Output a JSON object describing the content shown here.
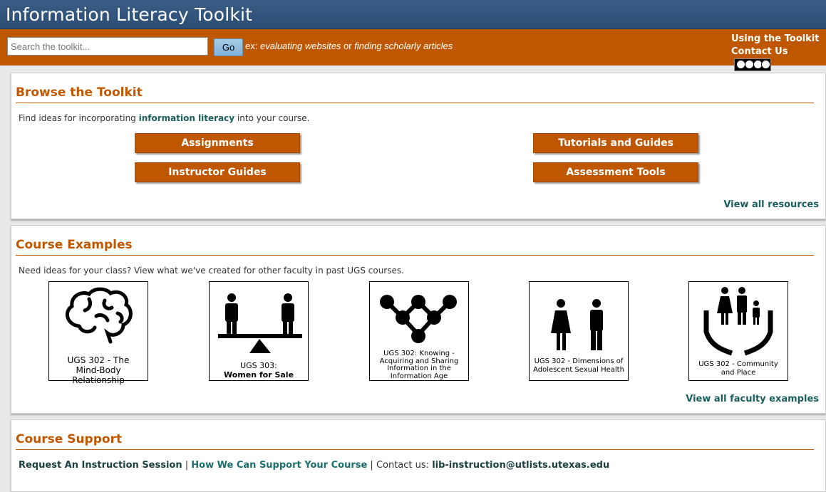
{
  "header": {
    "title": "Information Literacy Toolkit",
    "search_placeholder": "Search the toolkit...",
    "go_label": "Go",
    "hint_prefix": "ex: ",
    "hint_example1": "evaluating websites",
    "hint_or": " or ",
    "hint_example2": "finding scholarly articles",
    "link_using": "Using the Toolkit",
    "link_contact": "Contact Us"
  },
  "browse": {
    "heading": "Browse the Toolkit",
    "intro_before": "Find ideas for incorporating ",
    "intro_strong": "information literacy",
    "intro_after": " into your course.",
    "buttons": [
      "Assignments",
      "Tutorials and Guides",
      "Instructor Guides",
      "Assessment Tools"
    ],
    "view_all": "View all resources"
  },
  "courses": {
    "heading": "Course Examples",
    "intro": "Need ideas for your class? View what we've created for other faculty in past UGS courses.",
    "cards": [
      {
        "line1": "UGS 302 - The",
        "line2": "Mind-Body Relationship",
        "icon": "brain-icon"
      },
      {
        "line1": "UGS 303:",
        "line2": "Women for Sale",
        "icon": "seesaw-icon"
      },
      {
        "line1": "UGS 302: Knowing -",
        "line2": "Acquiring and Sharing",
        "line3": "Information in the",
        "line4": "Information Age",
        "icon": "network-icon"
      },
      {
        "line1": "UGS 302 - Dimensions of",
        "line2": "Adolescent Sexual Health",
        "icon": "couple-icon"
      },
      {
        "line1": "UGS 302 - Community",
        "line2": "and Place",
        "icon": "family-hands-icon"
      }
    ],
    "view_all": "View all faculty examples"
  },
  "support": {
    "heading": "Course Support",
    "link_request": "Request An Instruction Session",
    "sep": " | ",
    "link_how": "How We Can Support Your Course",
    "contact_label": " | Contact us: ",
    "email": "lib-instruction@utlists.utexas.edu"
  }
}
